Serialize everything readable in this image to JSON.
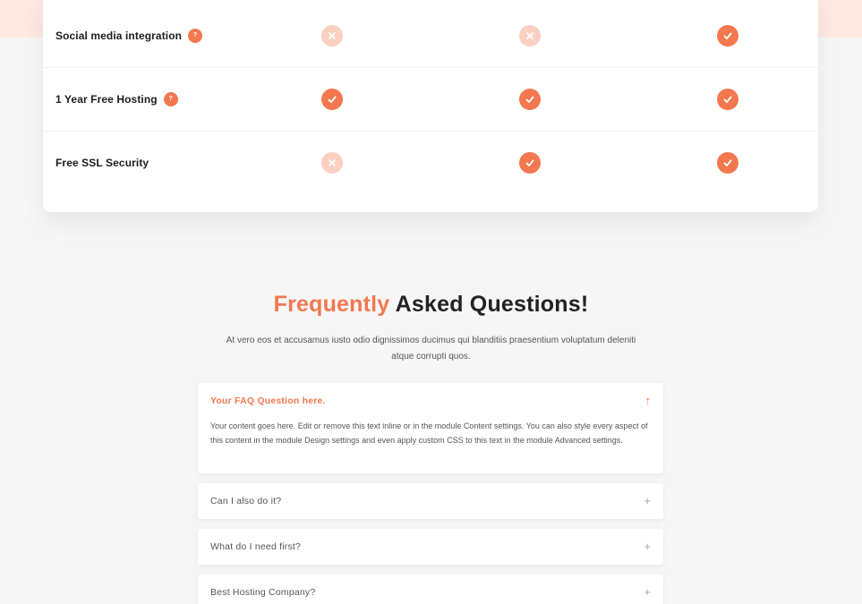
{
  "colors": {
    "accent": "#f3784f",
    "accent_light": "#fbd0c1",
    "background": "#f6f6f6",
    "card": "#ffffff"
  },
  "pricing_table": {
    "rows": [
      {
        "label": "Social media integration",
        "info_badge": "?",
        "plans": [
          "no",
          "no",
          "yes"
        ]
      },
      {
        "label": "1 Year Free Hosting",
        "info_badge": "?",
        "plans": [
          "yes",
          "yes",
          "yes"
        ]
      },
      {
        "label": "Free SSL Security",
        "info_badge": "",
        "plans": [
          "no",
          "yes",
          "yes"
        ]
      }
    ],
    "icons": {
      "yes": "check-icon",
      "no": "cross-icon"
    }
  },
  "faq": {
    "title_accent": "Frequently",
    "title_rest": " Asked Questions!",
    "subtitle": "At vero eos et accusamus iusto odio dignissimos ducimus qui blanditiis praesentium voluptatum deleniti atque corrupti quos.",
    "items": [
      {
        "question": "Your FAQ Question here.",
        "open": true,
        "toggle_icon": "↑",
        "answer": "Your content goes here. Edit or remove this text inline or in the module Content settings. You can also style every aspect of this content in the module Design settings and even apply custom CSS to this text in the module Advanced settings."
      },
      {
        "question": "Can I also do it?",
        "open": false,
        "toggle_icon": "+"
      },
      {
        "question": "What do I need first?",
        "open": false,
        "toggle_icon": "+"
      },
      {
        "question": "Best Hosting Company?",
        "open": false,
        "toggle_icon": "+"
      }
    ]
  }
}
